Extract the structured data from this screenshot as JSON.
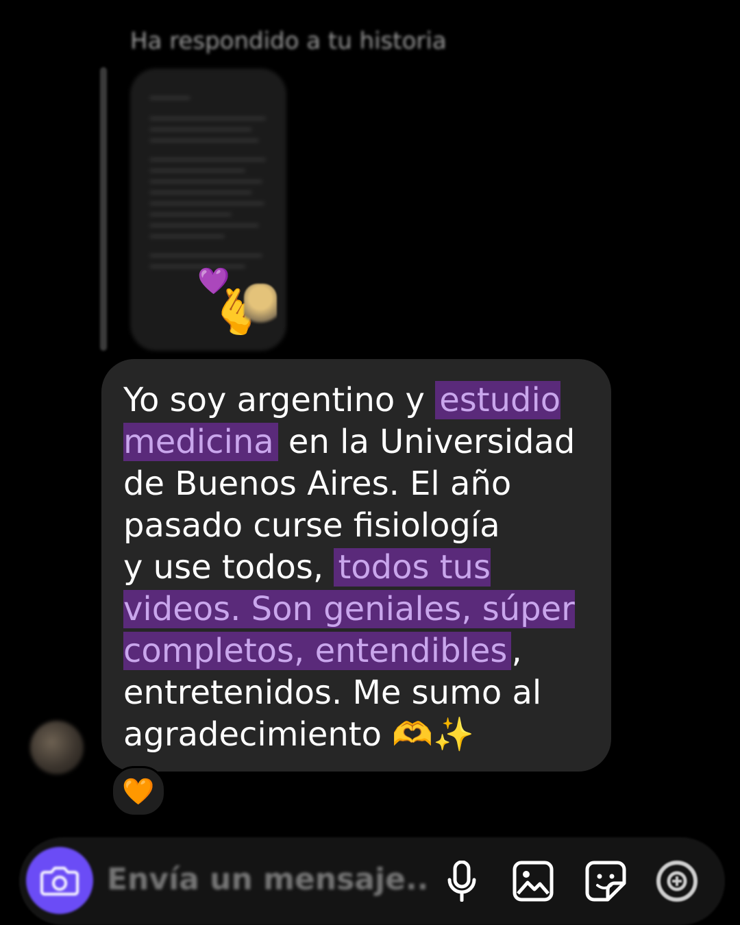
{
  "story": {
    "caption": "Ha respondido a tu historia",
    "sticker_heart": "💜",
    "sticker_hand": "🫰"
  },
  "message": {
    "segments": [
      {
        "text": "Yo soy argentino y ",
        "highlight": false
      },
      {
        "text": "estudio\nmedicina",
        "highlight": true
      },
      {
        "text": " en la Universidad\nde Buenos Aires. El año\npasado curse fisiología\ny use todos, ",
        "highlight": false
      },
      {
        "text": "todos tus\nvideos. Son geniales, súper\ncompletos, entendibles",
        "highlight": true
      },
      {
        "text": ",\nentretenidos. Me sumo al\nagradecimiento 🫶✨",
        "highlight": false
      }
    ],
    "reaction": "🧡"
  },
  "composer": {
    "placeholder": "Envía un mensaje...",
    "icons": [
      "camera-icon",
      "microphone-icon",
      "gallery-icon",
      "sticker-icon",
      "add-icon"
    ]
  },
  "colors": {
    "background": "#000000",
    "bubble": "#262626",
    "highlight_bg": "#5a2a7a",
    "highlight_text": "#c9a6ec",
    "camera_button": "#6b4cf6"
  }
}
